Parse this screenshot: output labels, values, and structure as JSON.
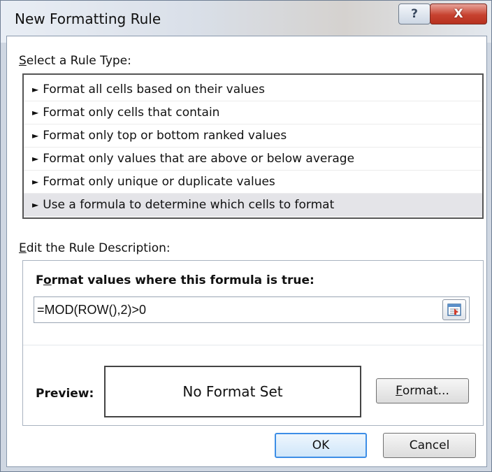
{
  "window": {
    "title": "New Formatting Rule",
    "help_label": "?",
    "close_label": "X"
  },
  "rule_type": {
    "label_prefix": "S",
    "label_rest": "elect a Rule Type:",
    "items": [
      {
        "label": "Format all cells based on their values",
        "selected": false
      },
      {
        "label": "Format only cells that contain",
        "selected": false
      },
      {
        "label": "Format only top or bottom ranked values",
        "selected": false
      },
      {
        "label": "Format only values that are above or below average",
        "selected": false
      },
      {
        "label": "Format only unique or duplicate values",
        "selected": false
      },
      {
        "label": "Use a formula to determine which cells to format",
        "selected": true
      }
    ]
  },
  "description": {
    "label_prefix": "E",
    "label_rest": "dit the Rule Description:",
    "formula_label_pre": "F",
    "formula_label_mid": "o",
    "formula_label_rest": "rmat values where this formula is true:",
    "formula_value": "=MOD(ROW(),2)>0",
    "preview_label": "Preview:",
    "preview_text": "No Format Set",
    "format_button_first": "F",
    "format_button_rest": "ormat..."
  },
  "footer": {
    "ok_label": "OK",
    "cancel_label": "Cancel"
  },
  "colors": {
    "selected_row": "#e4e4e8",
    "close_button": "#c74230",
    "ok_border": "#3d8ee6"
  },
  "icons": {
    "collapse_dialog": "range-selector-icon",
    "list_bullet": "arrow-right-icon"
  }
}
